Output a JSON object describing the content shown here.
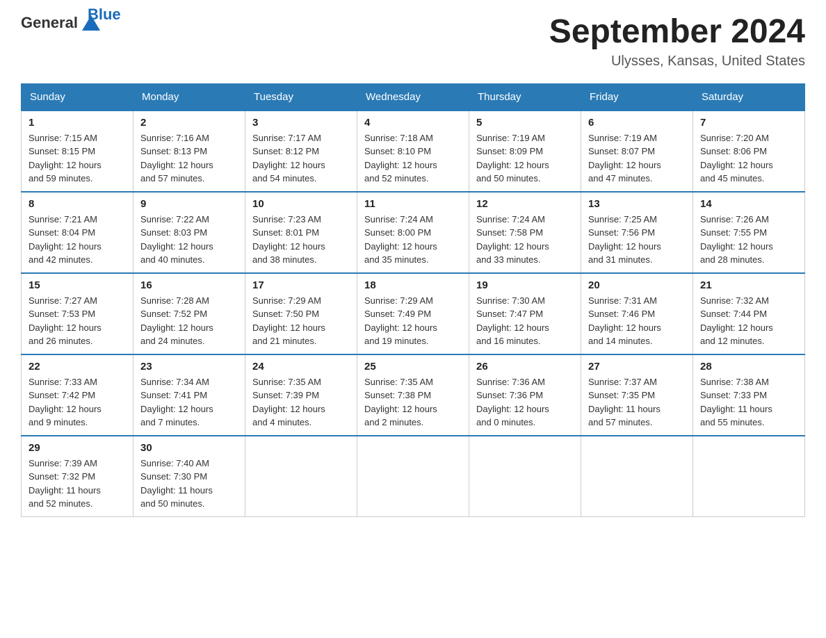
{
  "logo": {
    "text_general": "General",
    "text_blue": "Blue"
  },
  "title": "September 2024",
  "subtitle": "Ulysses, Kansas, United States",
  "days_of_week": [
    "Sunday",
    "Monday",
    "Tuesday",
    "Wednesday",
    "Thursday",
    "Friday",
    "Saturday"
  ],
  "weeks": [
    [
      {
        "day": "1",
        "sunrise": "7:15 AM",
        "sunset": "8:15 PM",
        "daylight": "12 hours and 59 minutes."
      },
      {
        "day": "2",
        "sunrise": "7:16 AM",
        "sunset": "8:13 PM",
        "daylight": "12 hours and 57 minutes."
      },
      {
        "day": "3",
        "sunrise": "7:17 AM",
        "sunset": "8:12 PM",
        "daylight": "12 hours and 54 minutes."
      },
      {
        "day": "4",
        "sunrise": "7:18 AM",
        "sunset": "8:10 PM",
        "daylight": "12 hours and 52 minutes."
      },
      {
        "day": "5",
        "sunrise": "7:19 AM",
        "sunset": "8:09 PM",
        "daylight": "12 hours and 50 minutes."
      },
      {
        "day": "6",
        "sunrise": "7:19 AM",
        "sunset": "8:07 PM",
        "daylight": "12 hours and 47 minutes."
      },
      {
        "day": "7",
        "sunrise": "7:20 AM",
        "sunset": "8:06 PM",
        "daylight": "12 hours and 45 minutes."
      }
    ],
    [
      {
        "day": "8",
        "sunrise": "7:21 AM",
        "sunset": "8:04 PM",
        "daylight": "12 hours and 42 minutes."
      },
      {
        "day": "9",
        "sunrise": "7:22 AM",
        "sunset": "8:03 PM",
        "daylight": "12 hours and 40 minutes."
      },
      {
        "day": "10",
        "sunrise": "7:23 AM",
        "sunset": "8:01 PM",
        "daylight": "12 hours and 38 minutes."
      },
      {
        "day": "11",
        "sunrise": "7:24 AM",
        "sunset": "8:00 PM",
        "daylight": "12 hours and 35 minutes."
      },
      {
        "day": "12",
        "sunrise": "7:24 AM",
        "sunset": "7:58 PM",
        "daylight": "12 hours and 33 minutes."
      },
      {
        "day": "13",
        "sunrise": "7:25 AM",
        "sunset": "7:56 PM",
        "daylight": "12 hours and 31 minutes."
      },
      {
        "day": "14",
        "sunrise": "7:26 AM",
        "sunset": "7:55 PM",
        "daylight": "12 hours and 28 minutes."
      }
    ],
    [
      {
        "day": "15",
        "sunrise": "7:27 AM",
        "sunset": "7:53 PM",
        "daylight": "12 hours and 26 minutes."
      },
      {
        "day": "16",
        "sunrise": "7:28 AM",
        "sunset": "7:52 PM",
        "daylight": "12 hours and 24 minutes."
      },
      {
        "day": "17",
        "sunrise": "7:29 AM",
        "sunset": "7:50 PM",
        "daylight": "12 hours and 21 minutes."
      },
      {
        "day": "18",
        "sunrise": "7:29 AM",
        "sunset": "7:49 PM",
        "daylight": "12 hours and 19 minutes."
      },
      {
        "day": "19",
        "sunrise": "7:30 AM",
        "sunset": "7:47 PM",
        "daylight": "12 hours and 16 minutes."
      },
      {
        "day": "20",
        "sunrise": "7:31 AM",
        "sunset": "7:46 PM",
        "daylight": "12 hours and 14 minutes."
      },
      {
        "day": "21",
        "sunrise": "7:32 AM",
        "sunset": "7:44 PM",
        "daylight": "12 hours and 12 minutes."
      }
    ],
    [
      {
        "day": "22",
        "sunrise": "7:33 AM",
        "sunset": "7:42 PM",
        "daylight": "12 hours and 9 minutes."
      },
      {
        "day": "23",
        "sunrise": "7:34 AM",
        "sunset": "7:41 PM",
        "daylight": "12 hours and 7 minutes."
      },
      {
        "day": "24",
        "sunrise": "7:35 AM",
        "sunset": "7:39 PM",
        "daylight": "12 hours and 4 minutes."
      },
      {
        "day": "25",
        "sunrise": "7:35 AM",
        "sunset": "7:38 PM",
        "daylight": "12 hours and 2 minutes."
      },
      {
        "day": "26",
        "sunrise": "7:36 AM",
        "sunset": "7:36 PM",
        "daylight": "12 hours and 0 minutes."
      },
      {
        "day": "27",
        "sunrise": "7:37 AM",
        "sunset": "7:35 PM",
        "daylight": "11 hours and 57 minutes."
      },
      {
        "day": "28",
        "sunrise": "7:38 AM",
        "sunset": "7:33 PM",
        "daylight": "11 hours and 55 minutes."
      }
    ],
    [
      {
        "day": "29",
        "sunrise": "7:39 AM",
        "sunset": "7:32 PM",
        "daylight": "11 hours and 52 minutes."
      },
      {
        "day": "30",
        "sunrise": "7:40 AM",
        "sunset": "7:30 PM",
        "daylight": "11 hours and 50 minutes."
      },
      null,
      null,
      null,
      null,
      null
    ]
  ],
  "labels": {
    "sunrise": "Sunrise:",
    "sunset": "Sunset:",
    "daylight": "Daylight:"
  }
}
